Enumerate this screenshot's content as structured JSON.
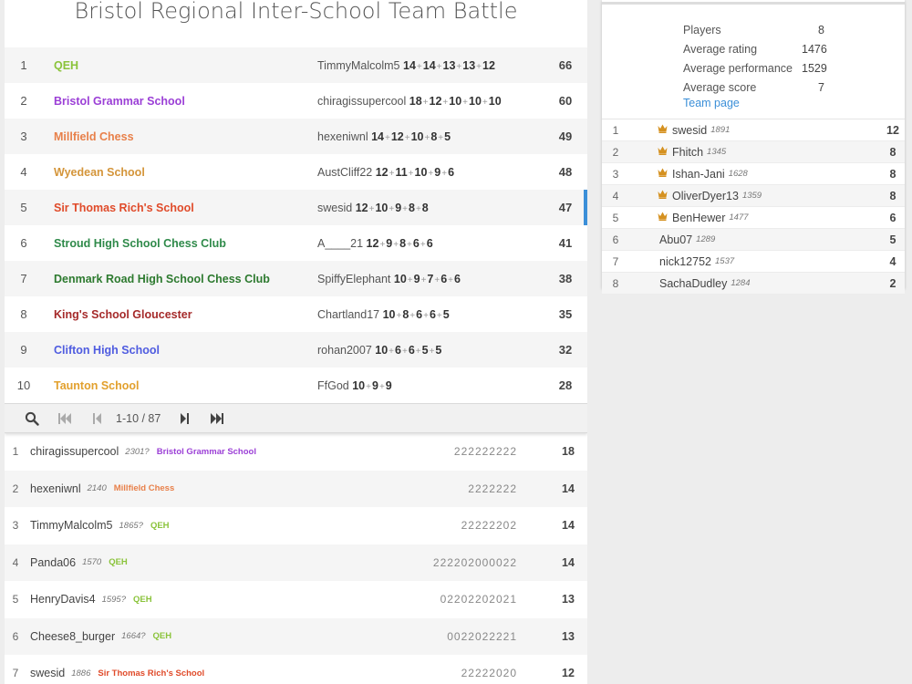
{
  "title": "Bristol Regional Inter-School Team Battle",
  "colors": {
    "link": "#3b8fd8",
    "crown": "#d59120",
    "selected_marker": "#3b8fd8"
  },
  "teams": [
    {
      "rank": "1",
      "name": "QEH",
      "color": "#8ac33a",
      "top": "TimmyMalcolm5",
      "scores": [
        "14",
        "14",
        "13",
        "13",
        "12"
      ],
      "total": "66"
    },
    {
      "rank": "2",
      "name": "Bristol Grammar School",
      "color": "#9b3fd6",
      "top": "chiragissupercool",
      "scores": [
        "18",
        "12",
        "10",
        "10",
        "10"
      ],
      "total": "60"
    },
    {
      "rank": "3",
      "name": "Millfield Chess",
      "color": "#e8804a",
      "top": "hexeniwnl",
      "scores": [
        "14",
        "12",
        "10",
        "8",
        "5"
      ],
      "total": "49"
    },
    {
      "rank": "4",
      "name": "Wyedean School",
      "color": "#d4953a",
      "top": "AustCliff22",
      "scores": [
        "12",
        "11",
        "10",
        "9",
        "6"
      ],
      "total": "48"
    },
    {
      "rank": "5",
      "name": "Sir Thomas Rich's School",
      "color": "#e04b2a",
      "top": "swesid",
      "scores": [
        "12",
        "10",
        "9",
        "8",
        "8"
      ],
      "total": "47"
    },
    {
      "rank": "6",
      "name": "Stroud High School Chess Club",
      "color": "#2f8a4a",
      "top": "A____21",
      "scores": [
        "12",
        "9",
        "8",
        "6",
        "6"
      ],
      "total": "41"
    },
    {
      "rank": "7",
      "name": "Denmark Road High School Chess Club",
      "color": "#2d7a2f",
      "top": "SpiffyElephant",
      "scores": [
        "10",
        "9",
        "7",
        "6",
        "6"
      ],
      "total": "38"
    },
    {
      "rank": "8",
      "name": "King's School Gloucester",
      "color": "#a52a2a",
      "top": "Chartland17",
      "scores": [
        "10",
        "8",
        "6",
        "6",
        "5"
      ],
      "total": "35"
    },
    {
      "rank": "9",
      "name": "Clifton High School",
      "color": "#4f5ce0",
      "top": "rohan2007",
      "scores": [
        "10",
        "6",
        "6",
        "5",
        "5"
      ],
      "total": "32"
    },
    {
      "rank": "10",
      "name": "Taunton School",
      "color": "#e2a02d",
      "top": "FfGod",
      "scores": [
        "10",
        "9",
        "9"
      ],
      "total": "28"
    }
  ],
  "pager": {
    "info": "1-10 / 87",
    "search_icon": "search-icon",
    "first_icon": "first-page-icon",
    "prev_icon": "prev-page-icon",
    "next_icon": "next-page-icon",
    "last_icon": "last-page-icon"
  },
  "players": [
    {
      "rank": "1",
      "name": "chiragissupercool",
      "rating": "2301?",
      "team": "Bristol Grammar School",
      "team_color": "#9b3fd6",
      "points": "222222222",
      "score": "18"
    },
    {
      "rank": "2",
      "name": "hexeniwnl",
      "rating": "2140",
      "team": "Millfield Chess",
      "team_color": "#e8804a",
      "points": "2222222",
      "score": "14"
    },
    {
      "rank": "3",
      "name": "TimmyMalcolm5",
      "rating": "1865?",
      "team": "QEH",
      "team_color": "#8ac33a",
      "points": "22222202",
      "score": "14"
    },
    {
      "rank": "4",
      "name": "Panda06",
      "rating": "1570",
      "team": "QEH",
      "team_color": "#8ac33a",
      "points": "222202000022",
      "score": "14"
    },
    {
      "rank": "5",
      "name": "HenryDavis4",
      "rating": "1595?",
      "team": "QEH",
      "team_color": "#8ac33a",
      "points": "02202202021",
      "score": "13"
    },
    {
      "rank": "6",
      "name": "Cheese8_burger",
      "rating": "1664?",
      "team": "QEH",
      "team_color": "#8ac33a",
      "points": "0022022221",
      "score": "13"
    },
    {
      "rank": "7",
      "name": "swesid",
      "rating": "1886",
      "team": "Sir Thomas Rich's School",
      "team_color": "#e04b2a",
      "points": "22222020",
      "score": "12"
    }
  ],
  "team_info": {
    "stats": [
      {
        "label": "Players",
        "value": "8"
      },
      {
        "label": "Average rating",
        "value": "1476"
      },
      {
        "label": "Average performance",
        "value": "1529"
      },
      {
        "label": "Average score",
        "value": "7"
      }
    ],
    "team_page_link": "Team page",
    "players": [
      {
        "rank": "1",
        "crown": true,
        "name": "swesid",
        "rating": "1891",
        "score": "12"
      },
      {
        "rank": "2",
        "crown": true,
        "name": "Fhitch",
        "rating": "1345",
        "score": "8"
      },
      {
        "rank": "3",
        "crown": true,
        "name": "Ishan-Jani",
        "rating": "1628",
        "score": "8"
      },
      {
        "rank": "4",
        "crown": true,
        "name": "OliverDyer13",
        "rating": "1359",
        "score": "8"
      },
      {
        "rank": "5",
        "crown": true,
        "name": "BenHewer",
        "rating": "1477",
        "score": "6"
      },
      {
        "rank": "6",
        "crown": false,
        "name": "Abu07",
        "rating": "1289",
        "score": "5"
      },
      {
        "rank": "7",
        "crown": false,
        "name": "nick12752",
        "rating": "1537",
        "score": "4"
      },
      {
        "rank": "8",
        "crown": false,
        "name": "SachaDudley",
        "rating": "1284",
        "score": "2"
      }
    ]
  }
}
